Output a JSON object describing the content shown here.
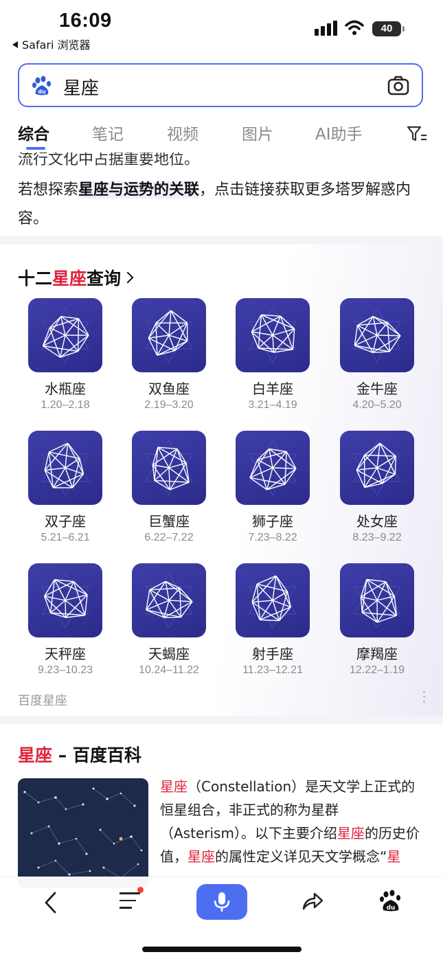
{
  "status_bar": {
    "time": "16:09",
    "back_app": "Safari 浏览器",
    "battery": "40"
  },
  "search": {
    "query": "星座"
  },
  "tabs": [
    {
      "label": "综合",
      "active": true
    },
    {
      "label": "笔记"
    },
    {
      "label": "视频"
    },
    {
      "label": "图片"
    },
    {
      "label": "AI助手"
    }
  ],
  "result_top": {
    "partial_line": "流行文化中占据重要地位。",
    "para_prefix": "若想探索",
    "para_highlight": "星座与运势的关联",
    "para_suffix": "，点击链接获取更多塔罗解惑内容。"
  },
  "zodiac": {
    "title_prefix": "十二",
    "title_red": "星座",
    "title_suffix": "查询",
    "signs": [
      {
        "name": "水瓶座",
        "date": "1.20–2.18"
      },
      {
        "name": "双鱼座",
        "date": "2.19–3.20"
      },
      {
        "name": "白羊座",
        "date": "3.21–4.19"
      },
      {
        "name": "金牛座",
        "date": "4.20–5.20"
      },
      {
        "name": "双子座",
        "date": "5.21–6.21"
      },
      {
        "name": "巨蟹座",
        "date": "6.22–7.22"
      },
      {
        "name": "狮子座",
        "date": "7.23–8.22"
      },
      {
        "name": "处女座",
        "date": "8.23–9.22"
      },
      {
        "name": "天秤座",
        "date": "9.23–10.23"
      },
      {
        "name": "天蝎座",
        "date": "10.24–11.22"
      },
      {
        "name": "射手座",
        "date": "11.23–12.21"
      },
      {
        "name": "摩羯座",
        "date": "12.22–1.19"
      }
    ],
    "source": "百度星座"
  },
  "baike": {
    "title_red": "星座",
    "title_suffix": " – 百度百科",
    "t1_red": "星座",
    "t1": "（Constellation）是天文学上正式的恒星组合，非正式的称为星群（Asterism）。以下主要介绍",
    "t2_red": "星座",
    "t2": "的历史价值，",
    "t3_red": "星座",
    "t3": "的属性定义详见天文学概念“",
    "t4_red": "星"
  },
  "colors": {
    "accent": "#4e6ef2",
    "red": "#e0243c",
    "zodiac_tile": "#33329a"
  }
}
